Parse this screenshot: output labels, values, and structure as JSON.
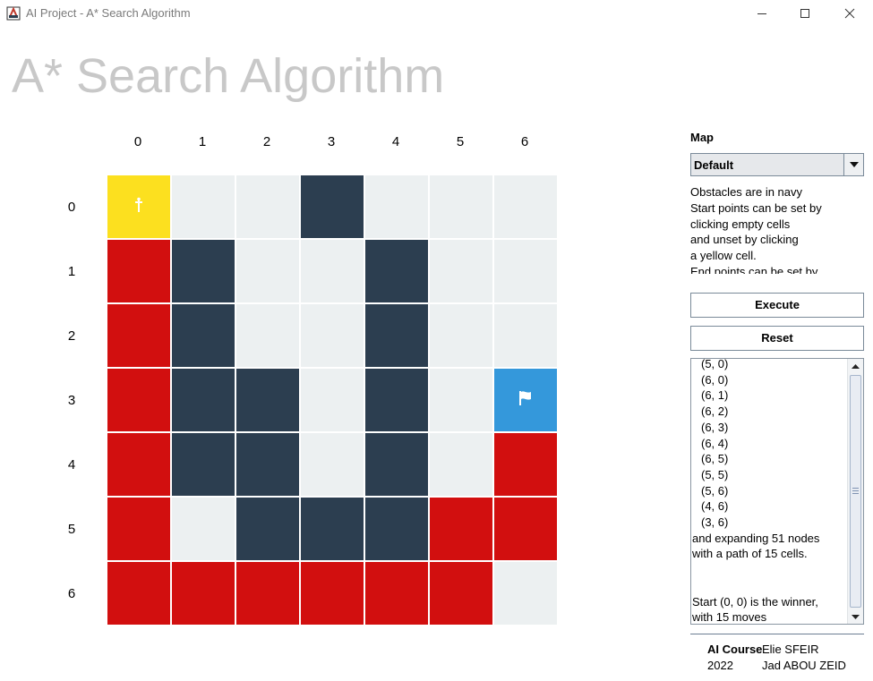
{
  "window": {
    "title": "AI Project - A* Search Algorithm"
  },
  "heading": "A* Search Algorithm",
  "grid": {
    "col_labels": [
      "0",
      "1",
      "2",
      "3",
      "4",
      "5",
      "6"
    ],
    "row_labels": [
      "0",
      "1",
      "2",
      "3",
      "4",
      "5",
      "6"
    ],
    "rows": [
      [
        "start",
        "empty",
        "empty",
        "wall",
        "empty",
        "empty",
        "empty"
      ],
      [
        "path",
        "wall",
        "empty",
        "empty",
        "wall",
        "empty",
        "empty"
      ],
      [
        "path",
        "wall",
        "empty",
        "empty",
        "wall",
        "empty",
        "empty"
      ],
      [
        "path",
        "wall",
        "wall",
        "empty",
        "wall",
        "empty",
        "end"
      ],
      [
        "path",
        "wall",
        "wall",
        "empty",
        "wall",
        "empty",
        "path"
      ],
      [
        "path",
        "empty",
        "wall",
        "wall",
        "wall",
        "path",
        "path"
      ],
      [
        "path",
        "path",
        "path",
        "path",
        "path",
        "path",
        "empty"
      ]
    ],
    "colors": {
      "empty": "#ECF0F1",
      "wall": "#2C3E50",
      "path": "#D20F0F",
      "start": "#FCE01F",
      "end": "#3498DB"
    },
    "icons": {
      "start": "start-marker-icon",
      "end": "flag-icon"
    }
  },
  "panel": {
    "map_label": "Map",
    "map_selected": "Default",
    "instructions": [
      "Obstacles are in navy",
      "Start points can be set by",
      "clicking empty cells",
      "and unset by clicking",
      "a yellow cell.",
      "End points can be set by"
    ],
    "execute_label": "Execute",
    "reset_label": "Reset",
    "output_coords": [
      "(5, 0)",
      "(6, 0)",
      "(6, 1)",
      "(6, 2)",
      "(6, 3)",
      "(6, 4)",
      "(6, 5)",
      "(5, 5)",
      "(5, 6)",
      "(4, 6)",
      "(3, 6)"
    ],
    "output_summary": [
      "and expanding 51 nodes",
      "with a path of 15 cells."
    ],
    "output_result": [
      "Start (0, 0) is the winner,",
      "with 15 moves"
    ]
  },
  "footer": {
    "course": "AI Course",
    "year": "2022",
    "author1": "Elie SFEIR",
    "author2": "Jad ABOU ZEID"
  }
}
